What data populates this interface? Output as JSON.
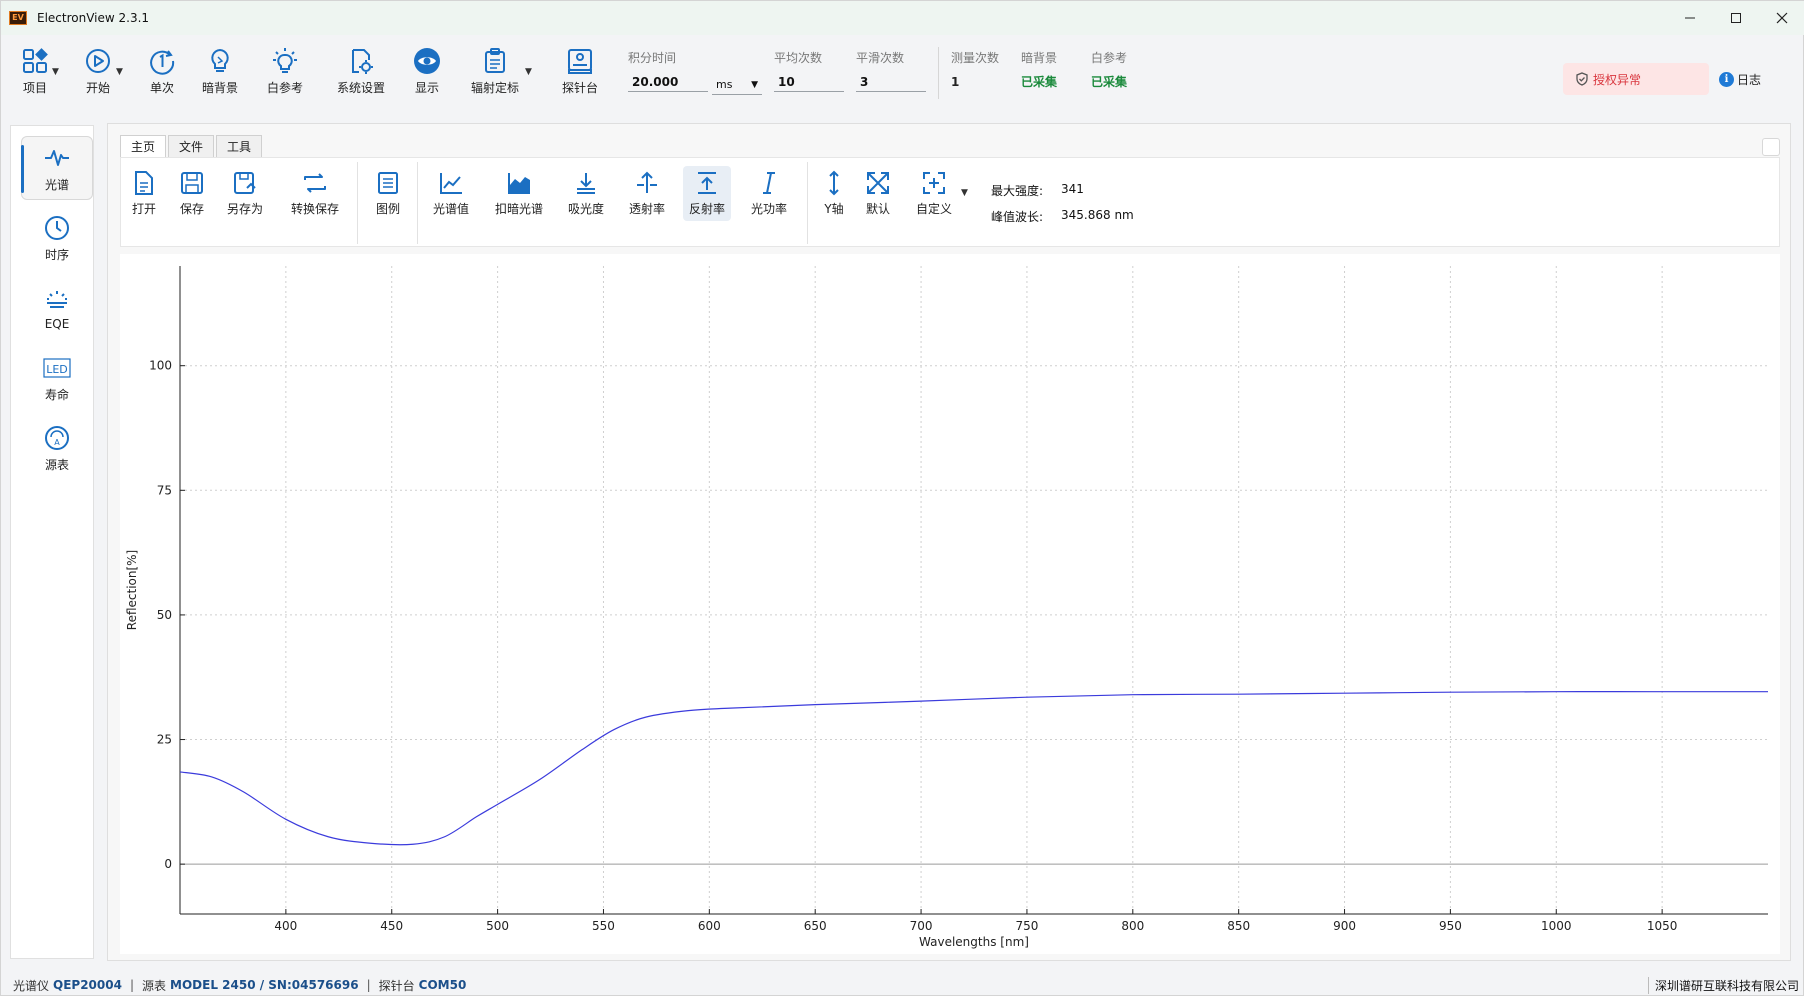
{
  "window": {
    "title": "ElectronView 2.3.1",
    "logo": "EV"
  },
  "ribbon": {
    "project": "项目",
    "start": "开始",
    "single": "单次",
    "dark_bg": "暗背景",
    "white_ref": "白参考",
    "settings": "系统设置",
    "display": "显示",
    "radiometric": "辐射定标",
    "probe_station": "探针台",
    "params": {
      "integration_time_label": "积分时间",
      "integration_time_value": "20.000",
      "unit": "ms",
      "avg_label": "平均次数",
      "avg_value": "10",
      "smooth_label": "平滑次数",
      "smooth_value": "3",
      "count_label": "测量次数",
      "count_value": "1",
      "dark_label": "暗背景",
      "dark_value": "已采集",
      "white_label": "白参考",
      "white_value": "已采集"
    },
    "license": "授权异常",
    "log": "日志"
  },
  "sidenav": [
    "光谱",
    "时序",
    "EQE",
    "寿命",
    "源表"
  ],
  "tabs": [
    "主页",
    "文件",
    "工具"
  ],
  "tools": {
    "open": "打开",
    "save": "保存",
    "save_as": "另存为",
    "convert_save": "转换保存",
    "legend": "图例",
    "spectrum": "光谱值",
    "dark_sub": "扣暗光谱",
    "absorbance": "吸光度",
    "transmittance": "透射率",
    "reflectance": "反射率",
    "optical_power": "光功率",
    "y_axis": "Y轴",
    "default": "默认",
    "custom": "自定义"
  },
  "stats": {
    "max_label": "最大强度:",
    "max_value": "341",
    "peak_label": "峰值波长:",
    "peak_value": "345.868 nm"
  },
  "chart_data": {
    "type": "line",
    "xlabel": "Wavelengths [nm]",
    "ylabel": "Reflection[%]",
    "xlim": [
      350,
      1100
    ],
    "ylim": [
      -10,
      120
    ],
    "xticks": [
      400,
      450,
      500,
      550,
      600,
      650,
      700,
      750,
      800,
      850,
      900,
      950,
      1000,
      1050
    ],
    "yticks": [
      0,
      25,
      50,
      75,
      100
    ],
    "grid": true,
    "color": "#3b3bdc",
    "series": [
      {
        "x": [
          350,
          365,
          380,
          400,
          420,
          440,
          460,
          475,
          490,
          500,
          520,
          540,
          555,
          570,
          590,
          610,
          650,
          700,
          750,
          800,
          850,
          900,
          950,
          1000,
          1050,
          1100
        ],
        "values": [
          18.5,
          17.5,
          14.5,
          9,
          5.5,
          4.2,
          4.0,
          5.5,
          9.5,
          12,
          17,
          23,
          27,
          29.5,
          30.8,
          31.3,
          32,
          32.7,
          33.5,
          34,
          34.1,
          34.3,
          34.5,
          34.6,
          34.6,
          34.6
        ]
      }
    ]
  },
  "status": {
    "spectrometer_label": "光谱仪",
    "spectrometer_value": "QEP20004",
    "sourcemeter_label": "源表",
    "sourcemeter_value": "MODEL 2450 / SN:04576696",
    "probe_label": "探针台",
    "probe_value": "COM50",
    "company": "深圳谱研互联科技有限公司"
  }
}
